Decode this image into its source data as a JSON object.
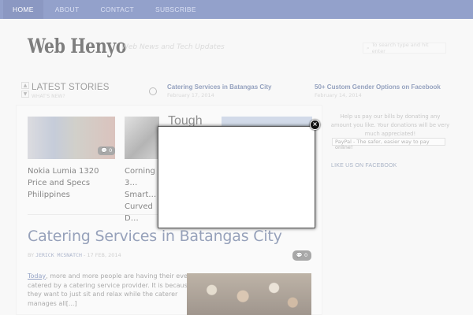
{
  "nav": {
    "items": [
      "HOME",
      "ABOUT",
      "CONTACT",
      "SUBSCRIBE"
    ]
  },
  "header": {
    "logo": "Web Henyo",
    "tagline": "Web News and Tech Updates",
    "search_placeholder": "To search type and hit enter"
  },
  "latest": {
    "title": "LATEST STORIES",
    "subtitle": "WHAT'S NEW?",
    "stories": [
      {
        "title": "Catering Services in Batangas City",
        "date": "February 17, 2014"
      },
      {
        "title": "50+ Custom Gender Options on Facebook",
        "date": "February 14, 2014"
      }
    ]
  },
  "cards": [
    {
      "title": "Nokia Lumia 1320 Price and Specs Philippines",
      "comments": "0"
    },
    {
      "title": "Corning 3… Smart… Curved D…",
      "thumb_text": "Tough"
    }
  ],
  "post": {
    "title": "Catering Services in Batangas City",
    "by": "BY",
    "author": "JERICK MCSNATCH",
    "date": "17 FEB, 2014",
    "comments": "0",
    "excerpt_link": "Today",
    "excerpt_rest": ", more and more people are having their event catered by a catering service provider. It is because they want to just sit and relax while the caterer manages all[...]"
  },
  "sidebar": {
    "donate_text": "Help us pay our bills by donating any amount you like. Your donations will be very much appreciated!",
    "paypal": "PayPal - The safer, easier way to pay online!",
    "like": "LIKE US ON FACEBOOK"
  },
  "modal": {
    "close_icon": "×"
  },
  "colors": {
    "nav_bg": "#5a6fb0",
    "link": "#5e6f96",
    "modal_bg": "#ffffff"
  }
}
